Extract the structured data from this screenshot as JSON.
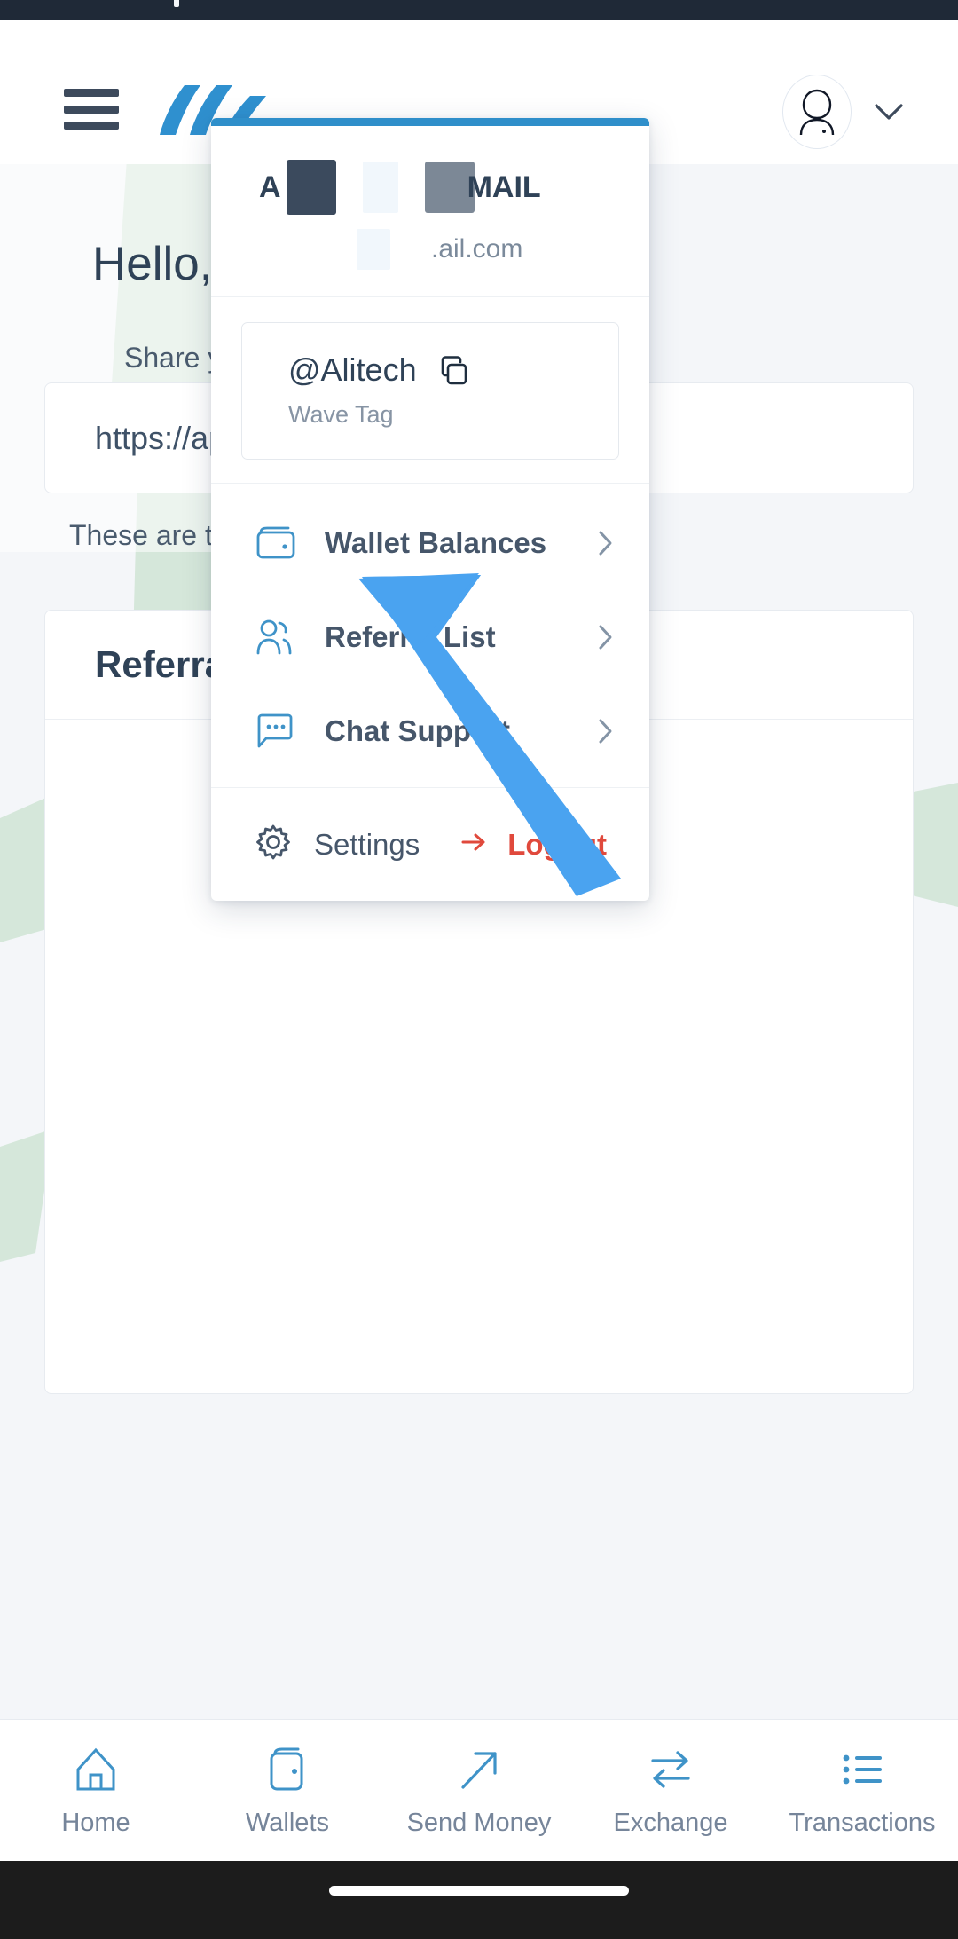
{
  "appbar": {
    "menu_icon": "hamburger-menu-icon",
    "logo_icon": "wave-brand-logo",
    "avatar_icon": "user-avatar-icon",
    "chevron_icon": "chevron-down-icon"
  },
  "page": {
    "greeting": "Hello, A",
    "subtitle": "Share you",
    "referral_link": "https://app.",
    "these_are": "These are the",
    "referrals_title": "Referrals"
  },
  "dropdown": {
    "accent_color": "#2f8fca",
    "name_prefix": "A",
    "name_suffix": "MAIL",
    "email_suffix": ".ail.com",
    "wave_tag": "@Alitech",
    "wave_tag_label": "Wave Tag",
    "copy_icon": "copy-icon",
    "items": [
      {
        "label": "Wallet Balances",
        "icon": "wallet-icon",
        "chevron": "chevron-right-icon"
      },
      {
        "label": "Referral List",
        "icon": "users-icon",
        "chevron": "chevron-right-icon"
      },
      {
        "label": "Chat Support",
        "icon": "chat-bubble-icon",
        "chevron": "chevron-right-icon"
      }
    ],
    "settings_label": "Settings",
    "settings_icon": "gear-icon",
    "logout_label": "Logout",
    "logout_icon": "logout-arrow-icon",
    "logout_color": "#e0493c"
  },
  "tabbar": {
    "items": [
      {
        "label": "Home",
        "icon": "home-icon"
      },
      {
        "label": "Wallets",
        "icon": "wallet-icon"
      },
      {
        "label": "Send Money",
        "icon": "arrow-up-right-icon"
      },
      {
        "label": "Exchange",
        "icon": "exchange-arrows-icon"
      },
      {
        "label": "Transactions",
        "icon": "list-icon"
      }
    ]
  }
}
